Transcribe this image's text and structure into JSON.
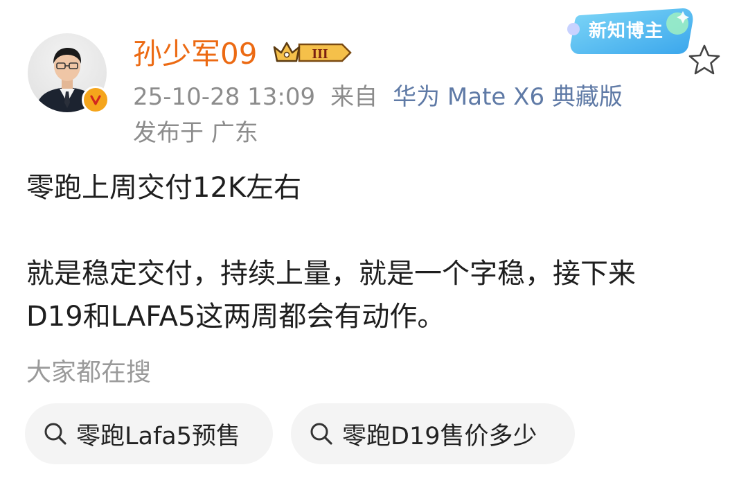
{
  "user": {
    "name": "孙少军09",
    "level_badge": "III",
    "verified_mark": "V"
  },
  "post_meta": {
    "date": "25-10-28 13:09",
    "from_label": "来自",
    "device": "华为 Mate X6 典藏版",
    "location": "发布于 广东"
  },
  "badge": {
    "label": "新知博主"
  },
  "post": {
    "line1": "零跑上周交付12K左右",
    "line2": "就是稳定交付，持续上量，就是一个字稳，接下来",
    "line3": "D19和LAFA5这两周都会有动作。"
  },
  "search_section": {
    "title": "大家都在搜",
    "chips": [
      "零跑Lafa5预售",
      "零跑D19售价多少"
    ]
  },
  "colors": {
    "username": "#ec6a13",
    "device_link": "#5f7aa6",
    "meta_gray": "#8c8c8c",
    "chip_bg": "#f4f4f4"
  },
  "icons": [
    "avatar-photo",
    "verified-v-icon",
    "crown-icon",
    "star-icon",
    "search-icon"
  ]
}
